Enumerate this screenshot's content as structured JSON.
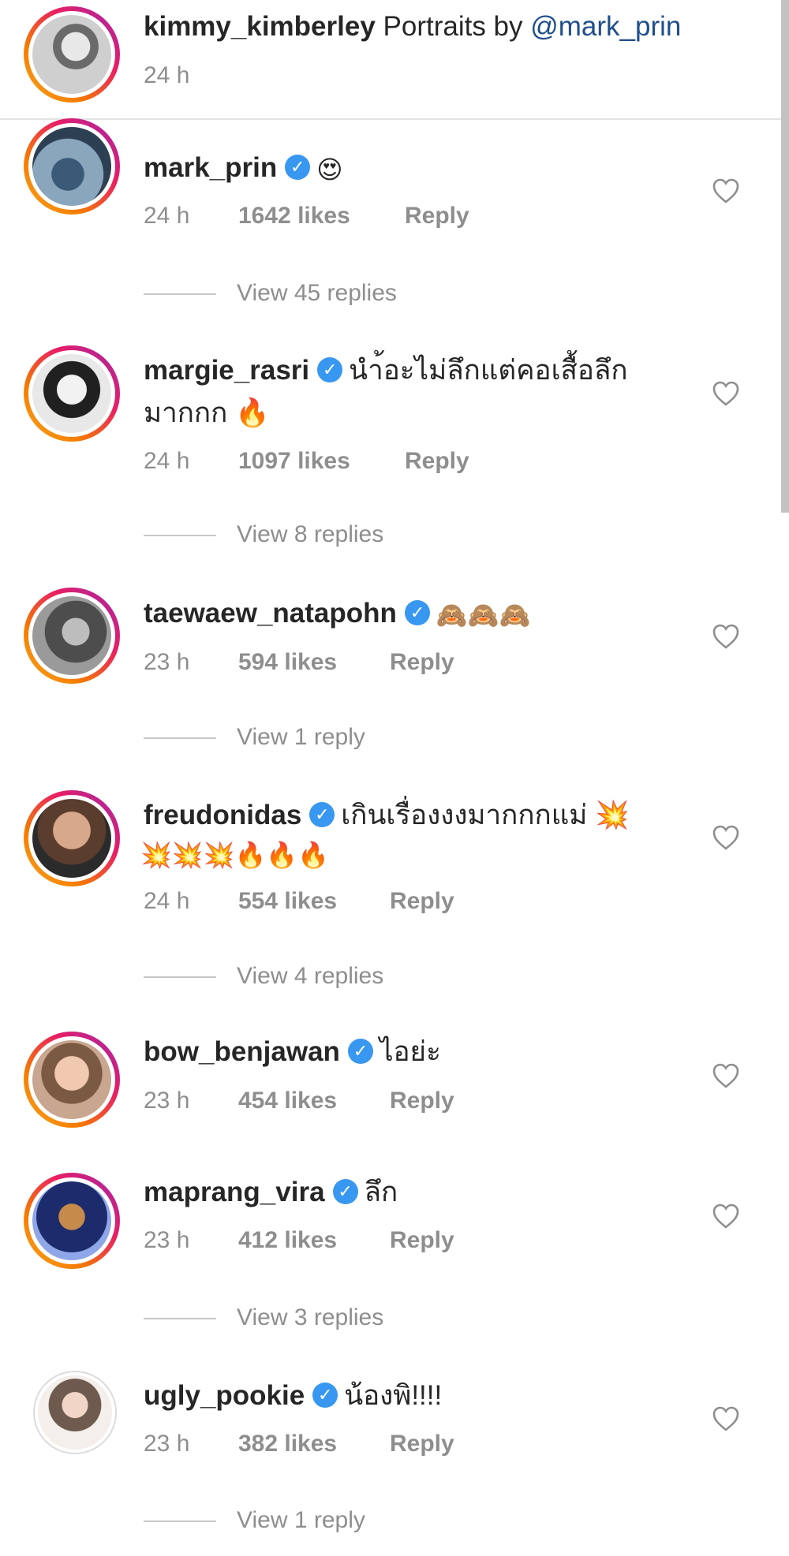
{
  "caption": {
    "username": "kimmy_kimberley",
    "text": " Portraits by ",
    "mention": "@mark_prin",
    "time": "24 h"
  },
  "comments": [
    {
      "username": "mark_prin",
      "text": "😍",
      "time": "24 h",
      "likes": "1642 likes",
      "reply": "Reply",
      "view_replies": "View 45 replies"
    },
    {
      "username": "margie_rasri",
      "text": "นำ้อะไม่ลึกแต่คอเสื้อลึก",
      "text2": "มากกก 🔥",
      "time": "24 h",
      "likes": "1097 likes",
      "reply": "Reply",
      "view_replies": "View 8 replies"
    },
    {
      "username": "taewaew_natapohn",
      "text": "🙈🙈🙈",
      "time": "23 h",
      "likes": "594 likes",
      "reply": "Reply",
      "view_replies": "View 1 reply"
    },
    {
      "username": "freudonidas",
      "text": "เกินเรื่องงงมากกกแม่ 💥",
      "text2": "💥💥💥🔥🔥🔥",
      "time": "24 h",
      "likes": "554 likes",
      "reply": "Reply",
      "view_replies": "View 4 replies"
    },
    {
      "username": "bow_benjawan",
      "text": "ไอย่ะ",
      "time": "23 h",
      "likes": "454 likes",
      "reply": "Reply"
    },
    {
      "username": "maprang_vira",
      "text": "ลึก",
      "time": "23 h",
      "likes": "412 likes",
      "reply": "Reply",
      "view_replies": "View 3 replies"
    },
    {
      "username": "ugly_pookie",
      "text": "น้องพิ!!!!",
      "time": "23 h",
      "likes": "382 likes",
      "reply": "Reply",
      "view_replies": "View 1 reply"
    }
  ],
  "icons": {
    "verified": "verified-badge-icon",
    "like": "heart-outline-icon"
  },
  "colors": {
    "verified": "#3897f0",
    "meta": "#8e8e8e",
    "mention": "#1f4e8c"
  }
}
